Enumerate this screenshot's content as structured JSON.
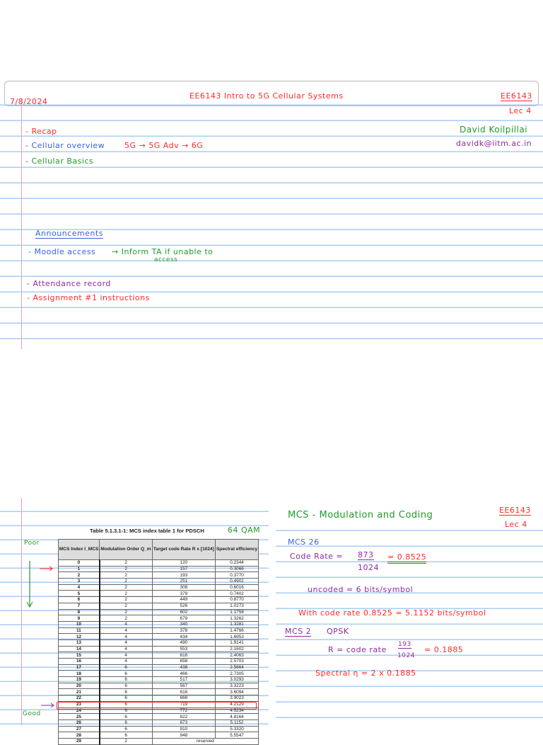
{
  "page1": {
    "date": "7/8/2024",
    "title": "EE6143   Intro to 5G Cellular Systems",
    "course": "EE6143",
    "lecture": "Lec 4",
    "instructor": "David Koilpillai",
    "email": "davidk@iitm.ac.in",
    "agenda": [
      "- Recap",
      "- Cellular overview"
    ],
    "evolution": "5G → 5G Adv → 6G",
    "basics": "- Cellular Basics",
    "announcements_heading": "Announcements",
    "moodle": "- Moodle access",
    "moodle_note": "→ Inform TA if unable to",
    "moodle_note2": "access",
    "attendance": "- Attendance record",
    "assignment": "- Assignment #1  instructions"
  },
  "page2": {
    "table_caption": "Table 5.1.3.1-1: MCS index table 1 for PDSCH",
    "annot_64qam": "64 QAM",
    "annot_poor": "Poor",
    "annot_good": "Good",
    "headers": [
      "MCS Index I_MCS",
      "Modulation Order Q_m",
      "Target code Rate R x [1024]",
      "Spectral efficiency"
    ],
    "rows": [
      [
        "0",
        "2",
        "120",
        "0.2344"
      ],
      [
        "1",
        "2",
        "157",
        "0.3066"
      ],
      [
        "2",
        "2",
        "193",
        "0.3770"
      ],
      [
        "3",
        "2",
        "251",
        "0.4902"
      ],
      [
        "4",
        "2",
        "308",
        "0.6016"
      ],
      [
        "5",
        "2",
        "379",
        "0.7402"
      ],
      [
        "6",
        "2",
        "449",
        "0.8770"
      ],
      [
        "7",
        "2",
        "526",
        "1.0273"
      ],
      [
        "8",
        "2",
        "602",
        "1.1758"
      ],
      [
        "9",
        "2",
        "679",
        "1.3262"
      ],
      [
        "10",
        "4",
        "340",
        "1.3281"
      ],
      [
        "11",
        "4",
        "378",
        "1.4766"
      ],
      [
        "12",
        "4",
        "434",
        "1.6953"
      ],
      [
        "13",
        "4",
        "490",
        "1.9141"
      ],
      [
        "14",
        "4",
        "553",
        "2.1602"
      ],
      [
        "15",
        "4",
        "616",
        "2.4063"
      ],
      [
        "16",
        "4",
        "658",
        "2.5703"
      ],
      [
        "17",
        "6",
        "438",
        "2.5664"
      ],
      [
        "18",
        "6",
        "466",
        "2.7305"
      ],
      [
        "19",
        "6",
        "517",
        "3.0293"
      ],
      [
        "20",
        "6",
        "567",
        "3.3223"
      ],
      [
        "21",
        "6",
        "616",
        "3.6094"
      ],
      [
        "22",
        "6",
        "666",
        "3.9023"
      ],
      [
        "23",
        "6",
        "719",
        "4.2129"
      ],
      [
        "24",
        "6",
        "772",
        "4.5234"
      ],
      [
        "25",
        "6",
        "822",
        "4.8164"
      ],
      [
        "26",
        "6",
        "873",
        "5.1152"
      ],
      [
        "27",
        "6",
        "910",
        "5.3320"
      ],
      [
        "28",
        "6",
        "948",
        "5.5547"
      ],
      [
        "29",
        "2",
        "reserved",
        ""
      ]
    ],
    "heading": "MCS  -  Modulation and Coding",
    "course": "EE6143",
    "lecture": "Lec 4",
    "mcs26": "MCS 26",
    "code_rate_label": "Code Rate  =",
    "num1": "873",
    "den1": "1024",
    "eq1": "=  0.8525",
    "uncoded": "uncoded  =  6 bits/symbol",
    "with_rate": "With code rate 0.8525  =  5.1152 bits/symbol",
    "mcs2": "MCS 2",
    "qpsk": "QPSK",
    "r_label": "R = code rate",
    "num2": "193",
    "den2": "1024",
    "eq2": "=  0.1885",
    "spectral": "Spectral η  =  2 x 0.1885"
  }
}
